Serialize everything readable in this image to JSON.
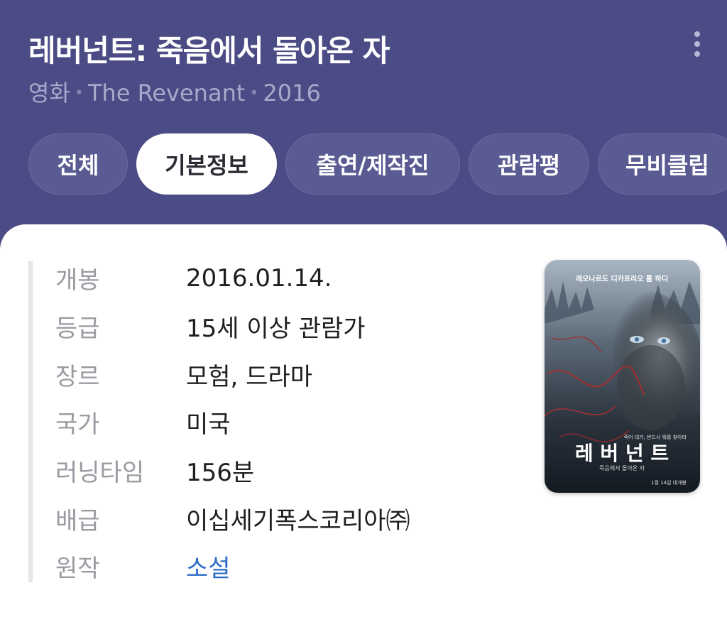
{
  "header": {
    "title": "레버넌트: 죽음에서 돌아온 자",
    "subtitle": {
      "type": "영화",
      "original_title": "The Revenant",
      "year": "2016",
      "separator": "•"
    },
    "more_icon": "more-vertical-icon"
  },
  "tabs": [
    {
      "label": "전체",
      "active": false
    },
    {
      "label": "기본정보",
      "active": true
    },
    {
      "label": "출연/제작진",
      "active": false
    },
    {
      "label": "관람평",
      "active": false
    },
    {
      "label": "무비클립",
      "active": false
    }
  ],
  "info": [
    {
      "label": "개봉",
      "value": "2016.01.14."
    },
    {
      "label": "등급",
      "value": "15세 이상 관람가"
    },
    {
      "label": "장르",
      "value": "모험, 드라마"
    },
    {
      "label": "국가",
      "value": "미국"
    },
    {
      "label": "러닝타임",
      "value": "156분"
    },
    {
      "label": "배급",
      "value": "이십세기폭스코리아㈜"
    },
    {
      "label": "원작",
      "value": "소설"
    }
  ],
  "poster": {
    "top_text": "레오나르도 디카프리오    톰 하디",
    "tagline": "죽어 대가, 반드시 뭐를 찾아라",
    "title": "레 버 넌 트",
    "subtitle": "죽음에서 돌아온 자",
    "release_note": "1월 14일 대개봉"
  },
  "colors": {
    "header_bg": "#4b4b85",
    "tab_bg": "#5b5b93",
    "tab_active_bg": "#ffffff",
    "link": "#2c6bc7"
  }
}
